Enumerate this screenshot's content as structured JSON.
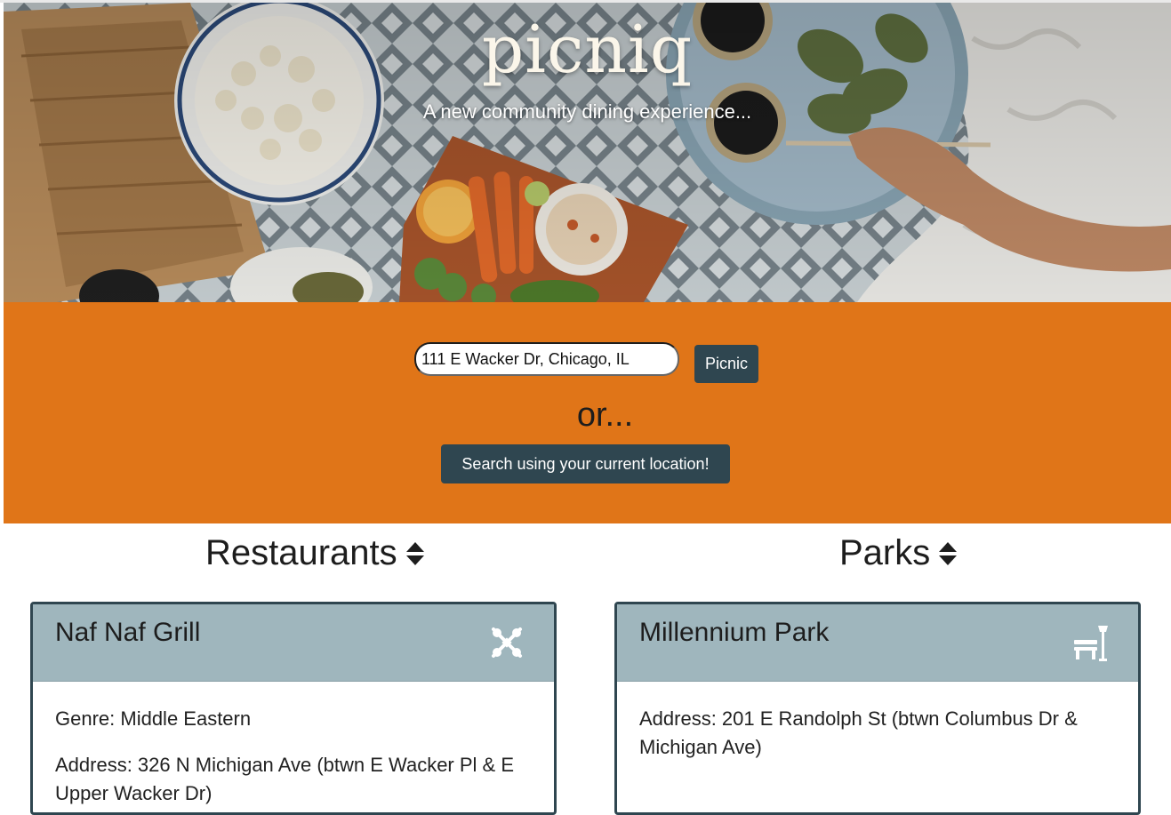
{
  "hero": {
    "title": "picniq",
    "tagline": "A new community dining experience..."
  },
  "search": {
    "address_value": "111 E Wacker Dr, Chicago, IL",
    "picnic_label": "Picnic",
    "or_text": "or...",
    "geo_label": "Search using your current location!"
  },
  "restaurants": {
    "heading": "Restaurants",
    "sort_icon": "sort-icon",
    "card": {
      "name": "Naf Naf Grill",
      "icon": "utensils-crossed-icon",
      "genre": "Genre: Middle Eastern",
      "address": "Address: 326 N Michigan Ave (btwn E Wacker Pl & E Upper Wacker Dr)"
    }
  },
  "parks": {
    "heading": "Parks",
    "sort_icon": "sort-icon",
    "card": {
      "name": "Millennium Park",
      "icon": "park-bench-icon",
      "address": "Address: 201 E Randolph St (btwn Columbus Dr & Michigan Ave)"
    }
  },
  "colors": {
    "accent_orange": "#e07518",
    "button_dark": "#2f4650",
    "card_header": "#9fb6bd"
  }
}
